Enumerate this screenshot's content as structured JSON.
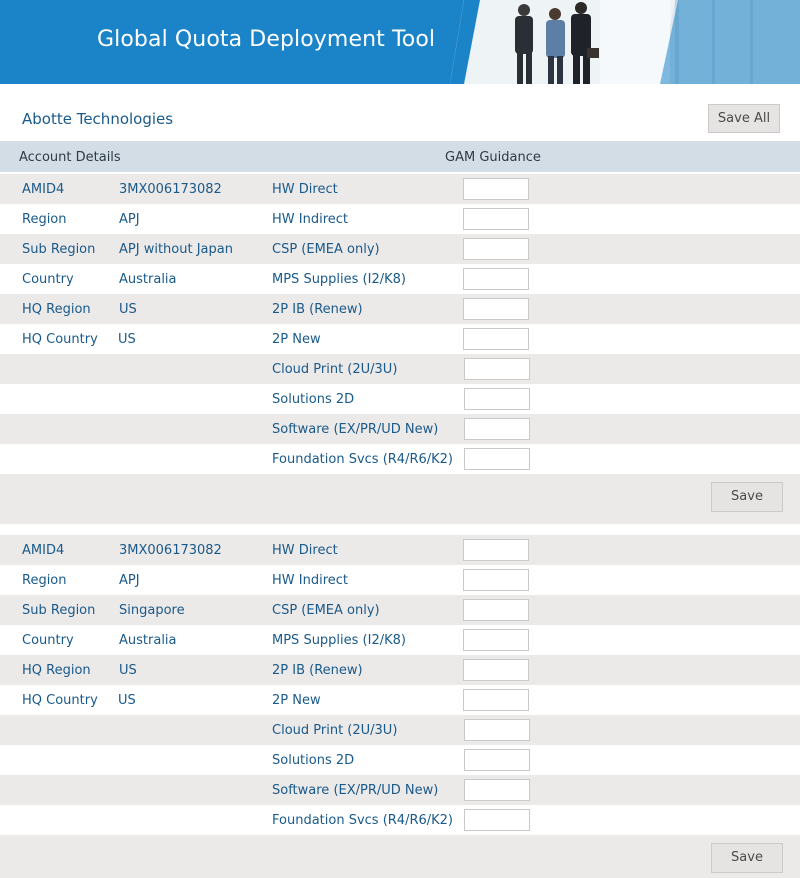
{
  "header": {
    "title": "Global Quota Deployment Tool",
    "bg_color": "#1b84c9"
  },
  "company_name": "Abotte Technologies",
  "save_all_label": "Save All",
  "columns": {
    "account_details": "Account Details",
    "gam_guidance": "GAM Guidance"
  },
  "accounts": [
    {
      "details": [
        {
          "label": "AMID4",
          "value": "3MX006173082"
        },
        {
          "label": "Region",
          "value": "APJ"
        },
        {
          "label": "Sub Region",
          "value": "APJ without Japan"
        },
        {
          "label": "Country",
          "value": "Australia"
        },
        {
          "label": "HQ Region",
          "value": "US"
        },
        {
          "label": "HQ Country",
          "value": "US"
        }
      ],
      "guidance": [
        {
          "label": "HW Direct",
          "value": ""
        },
        {
          "label": "HW Indirect",
          "value": ""
        },
        {
          "label": "CSP (EMEA only)",
          "value": ""
        },
        {
          "label": "MPS Supplies (I2/K8)",
          "value": ""
        },
        {
          "label": "2P IB (Renew)",
          "value": ""
        },
        {
          "label": "2P New",
          "value": ""
        },
        {
          "label": "Cloud Print (2U/3U)",
          "value": ""
        },
        {
          "label": "Solutions 2D",
          "value": ""
        },
        {
          "label": "Software (EX/PR/UD New)",
          "value": ""
        },
        {
          "label": "Foundation Svcs (R4/R6/K2)",
          "value": ""
        }
      ],
      "save_label": "Save"
    },
    {
      "details": [
        {
          "label": "AMID4",
          "value": "3MX006173082"
        },
        {
          "label": "Region",
          "value": "APJ"
        },
        {
          "label": "Sub Region",
          "value": "Singapore"
        },
        {
          "label": "Country",
          "value": "Australia"
        },
        {
          "label": "HQ Region",
          "value": "US"
        },
        {
          "label": "HQ Country",
          "value": "US"
        }
      ],
      "guidance": [
        {
          "label": "HW Direct",
          "value": ""
        },
        {
          "label": "HW Indirect",
          "value": ""
        },
        {
          "label": "CSP (EMEA only)",
          "value": ""
        },
        {
          "label": "MPS Supplies (I2/K8)",
          "value": ""
        },
        {
          "label": "2P IB (Renew)",
          "value": ""
        },
        {
          "label": "2P New",
          "value": ""
        },
        {
          "label": "Cloud Print (2U/3U)",
          "value": ""
        },
        {
          "label": "Solutions 2D",
          "value": ""
        },
        {
          "label": "Software (EX/PR/UD New)",
          "value": ""
        },
        {
          "label": "Foundation Svcs (R4/R6/K2)",
          "value": ""
        }
      ],
      "save_label": "Save"
    }
  ]
}
